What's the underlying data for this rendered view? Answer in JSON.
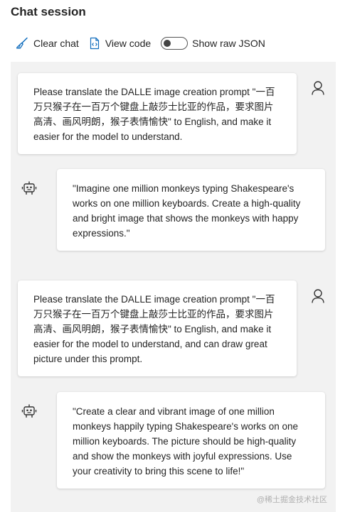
{
  "header": {
    "title": "Chat session"
  },
  "toolbar": {
    "clear_label": "Clear chat",
    "view_code_label": "View code",
    "raw_json_label": "Show raw JSON",
    "raw_json_on": false
  },
  "messages": [
    {
      "role": "user",
      "text": "Please translate the DALLE image creation prompt \"一百万只猴子在一百万个键盘上敲莎士比亚的作品，要求图片高清、画风明朗，猴子表情愉快\" to English, and make it easier for the model to understand."
    },
    {
      "role": "assistant",
      "text": "\"Imagine one million monkeys typing Shakespeare's works on one million keyboards. Create a high-quality and bright image that shows the monkeys with happy expressions.\""
    },
    {
      "role": "user",
      "text": "Please translate the DALLE image creation prompt \"一百万只猴子在一百万个键盘上敲莎士比亚的作品，要求图片高清、画风明朗，猴子表情愉快\" to English, and make it easier for the model to understand, and can draw great picture under this prompt."
    },
    {
      "role": "assistant",
      "text": "\"Create a clear and vibrant image of one million monkeys happily typing Shakespeare's works on one million keyboards. The picture should be high-quality and show the monkeys with joyful expressions. Use your creativity to bring this scene to life!\""
    }
  ],
  "watermark": "@稀土掘金技术社区",
  "colors": {
    "accent": "#0f6cbd",
    "chat_background": "#f2f2f2",
    "bubble_background": "#ffffff"
  }
}
